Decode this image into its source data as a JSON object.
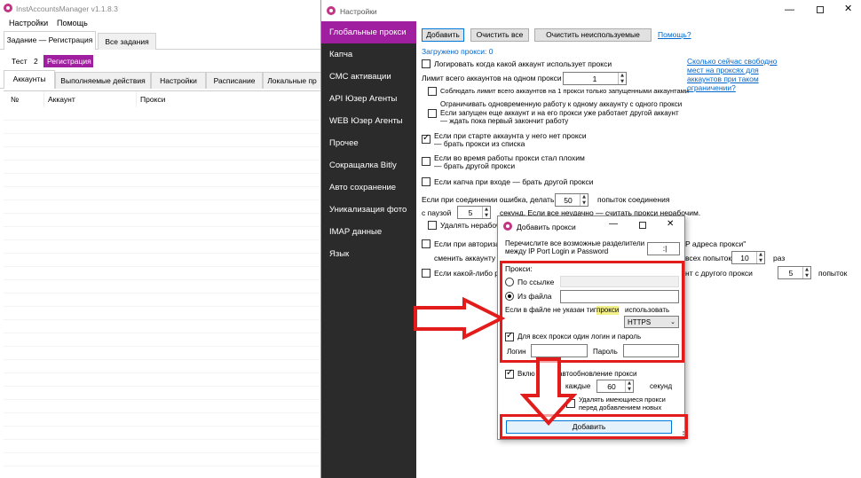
{
  "main_window": {
    "title": "InstAccountsManager v1.1.8.3",
    "menu": [
      "Настройки",
      "Помощь"
    ],
    "task_tabs": [
      "Задание — Регистрация",
      "Все задания"
    ],
    "tags": [
      "Тест",
      "2",
      "Регистрация"
    ],
    "sub_tabs": [
      "Аккаунты",
      "Выполняемые действия",
      "Настройки",
      "Расписание",
      "Локальные пр"
    ],
    "table_headers": [
      "№",
      "Аккаунт",
      "Прокси"
    ]
  },
  "settings": {
    "title": "Настройки",
    "nav": [
      "Глобальные прокси",
      "Капча",
      "СМС активации",
      "API Юзер Агенты",
      "WEB Юзер Агенты",
      "Прочее",
      "Сокращалка Bitly",
      "Авто сохранение",
      "Уникализация фото",
      "IMAP данные",
      "Язык"
    ],
    "btn_add": "Добавить",
    "btn_clear_all": "Очистить все",
    "btn_clear_unused": "Очистить неиспользуемые",
    "help_link": "Помощь?",
    "loaded": "Загружено прокси: 0",
    "side_link": "Сколько сейчас свободно мест на проксях для аккаунтов при таком ограничении?",
    "opt_log": "Логировать когда какой аккаунт использует прокси",
    "limit_label": "Лимит всего аккаунтов на одном прокси",
    "limit_value": "1",
    "opt_limit_running": "Соблюдать лимит всего аккаунтов на 1 прокси только запущенными аккаунтами",
    "opt_one_line1": "Ограничивать одновременную работу к одному аккаунту с одного прокси",
    "opt_one_line2": "Если запущен еще аккаунт и на его прокси уже работает другой аккаунт",
    "opt_one_line3": "— ждать пока первый закончит работу",
    "opt_start_1": "Если при старте аккаунта у него нет прокси",
    "opt_start_2": "— брать прокси из списка",
    "opt_bad_1": "Если во время работы прокси стал плохим",
    "opt_bad_2": "— брать другой прокси",
    "opt_captcha": "Если капча при входе — брать другой прокси",
    "err_label": "Если при соединении ошибка, делать",
    "err_value": "50",
    "err_suffix": "попыток соединения",
    "pause_label": "с паузой",
    "pause_value": "5",
    "pause_suffix": "секунд. Если все неудачно — считать прокси нерабочим.",
    "opt_delete": "Удалять нерабоч",
    "opt_auth_1": "Если при авторизац",
    "opt_auth_1r": "P адреса прокси\"",
    "opt_auth_2": "сменить аккаунту пр",
    "opt_auth_2r": "всех попыток",
    "auth_value": "10",
    "auth_suffix": "раз",
    "opt_any": "Если какой-либо рал",
    "opt_any_r": "нт с другого прокси",
    "any_value": "5",
    "any_suffix": "попыток"
  },
  "dialog": {
    "title": "Добавить прокси",
    "sep_label_1": "Перечислите все возможные разделители",
    "sep_label_2": "между IP Port Login и Password",
    "sep_value": ":|",
    "proxy_label": "Прокси:",
    "by_link": "По ссылке",
    "from_file": "Из файла",
    "type_label_pre": "Если в файле не указан тип",
    "type_label_hl": "прокси",
    "type_label_post": "использовать",
    "type_value": "HTTPS",
    "same_login": "Для всех прокси один логин и пароль",
    "login_label": "Логин",
    "password_label": "Пароль",
    "auto_update_pre": "Вклю",
    "auto_update_post": "автообновление прокси",
    "every_label": "каждые",
    "every_value": "60",
    "seconds_label": "секунд",
    "delete_existing_1": "Удалять имеющиеся прокси",
    "delete_existing_2": "перед добавлением новых",
    "add_button": "Добавить"
  },
  "colors": {
    "accent_purple": "#a01fa0",
    "nav_bg": "#2b2b2b",
    "annotation_red": "#e21b1b",
    "link_blue": "#0066cc"
  }
}
